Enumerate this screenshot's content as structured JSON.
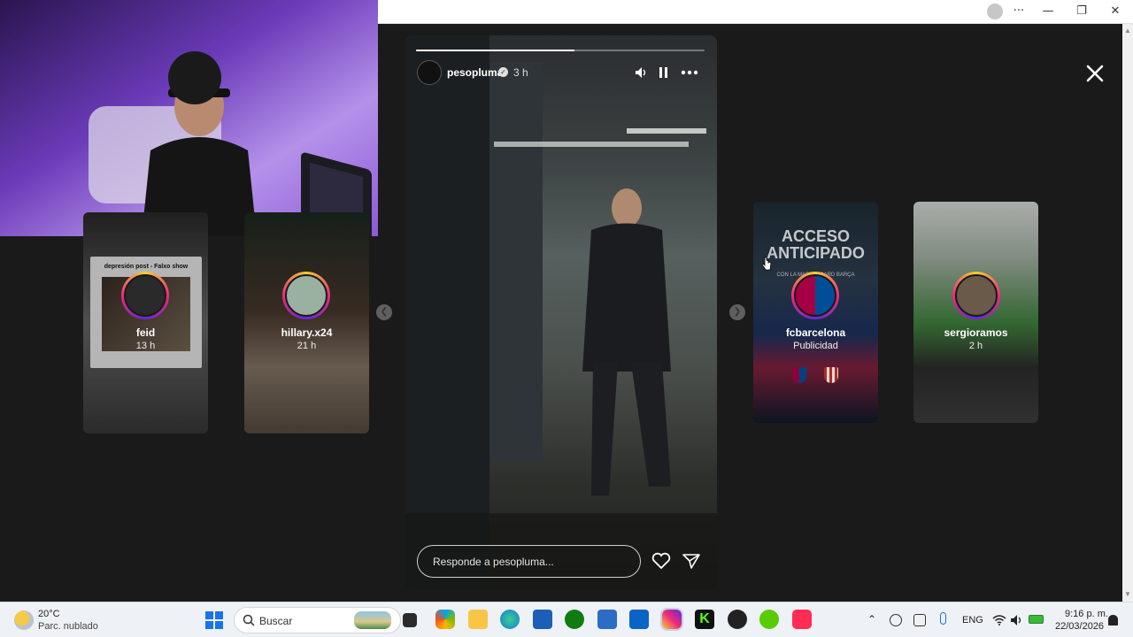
{
  "browser": {
    "controls": {
      "more": "···",
      "minimize": "—",
      "restore": "❐",
      "close": "✕"
    }
  },
  "side_stories": [
    {
      "username": "feid",
      "time": "13 h",
      "caption_top": "depresión post - Falxo show"
    },
    {
      "username": "hillary.x24",
      "time": "21 h"
    },
    {
      "username": "fcbarcelona",
      "time": "Publicidad",
      "headline": "ACCESO ANTICIPADO",
      "subline": "CON LA MASTERCARD BARÇA"
    },
    {
      "username": "sergioramos",
      "time": "2 h"
    }
  ],
  "main_story": {
    "username": "pesopluma",
    "verified": true,
    "time": "3 h",
    "progress": 0.55,
    "reply_placeholder": "Responde a pesopluma...",
    "icons": {
      "mute": "volume-icon",
      "pause": "pause-icon",
      "more": "more-icon",
      "like": "heart-icon",
      "share": "send-icon"
    }
  },
  "taskbar": {
    "weather": {
      "temp": "20°C",
      "desc": "Parc. nublado"
    },
    "search_placeholder": "Buscar",
    "lang": "ENG",
    "time": "9:16 p. m.",
    "date": "22/03/2026"
  },
  "colors": {
    "ig_gradient": [
      "#f9ce34",
      "#ee2a7b",
      "#6228d7"
    ],
    "taskbar": "#eef1f5"
  }
}
